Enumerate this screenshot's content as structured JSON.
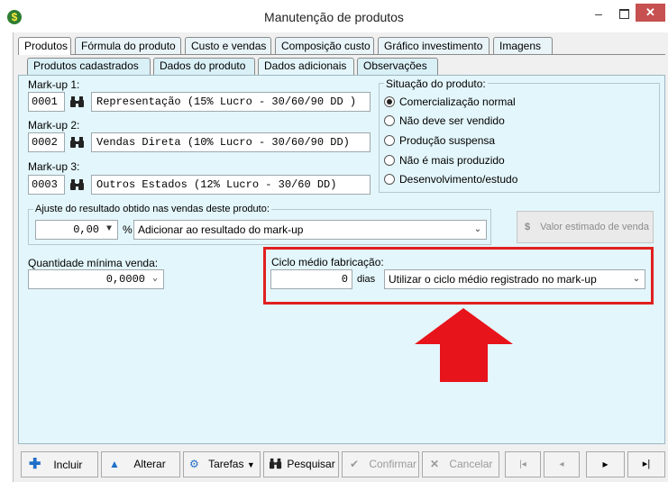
{
  "window": {
    "title": "Manutenção de produtos",
    "icon": "dollar-coin-icon",
    "minimize_glyph": "–",
    "close_glyph": "✕"
  },
  "tabs": [
    "Produtos",
    "Fórmula do produto",
    "Custo e vendas",
    "Composição custo",
    "Gráfico investimento",
    "Imagens"
  ],
  "subtabs": [
    "Produtos cadastrados",
    "Dados do produto",
    "Dados adicionais",
    "Observações"
  ],
  "markups": [
    {
      "label": "Mark-up 1:",
      "code": "0001",
      "description": "Representação (15% Lucro - 30/60/90 DD )"
    },
    {
      "label": "Mark-up 2:",
      "code": "0002",
      "description": "Vendas Direta (10% Lucro - 30/60/90 DD)"
    },
    {
      "label": "Mark-up 3:",
      "code": "0003",
      "description": "Outros Estados (12% Lucro - 30/60 DD)"
    }
  ],
  "situacao": {
    "title": "Situação do produto:",
    "options": [
      "Comercialização normal",
      "Não deve ser vendido",
      "Produção suspensa",
      "Não é mais produzido",
      "Desenvolvimento/estudo"
    ],
    "selected": "Comercialização normal"
  },
  "ajuste": {
    "title": "Ajuste do resultado obtido nas vendas deste produto:",
    "value": "0,00",
    "unit": "%",
    "mode": "Adicionar ao resultado do mark-up"
  },
  "valor_estimado_label": "Valor estimado de venda",
  "quantidade": {
    "label": "Quantidade mínima venda:",
    "value": "0,0000"
  },
  "ciclo": {
    "label": "Ciclo médio fabricação:",
    "value": "0",
    "unit": "dias",
    "mode": "Utilizar o ciclo médio registrado no mark-up"
  },
  "annotation": {
    "highlight_color": "#e02020",
    "arrow_color": "#e8141b"
  },
  "toolbar": {
    "incluir": "Incluir",
    "alterar": "Alterar",
    "tarefas": "Tarefas",
    "pesquisar": "Pesquisar",
    "confirmar": "Confirmar",
    "cancelar": "Cancelar",
    "glyph_first": "|◂",
    "glyph_prev": "◂",
    "glyph_next": "▸",
    "glyph_last": "▸|"
  }
}
